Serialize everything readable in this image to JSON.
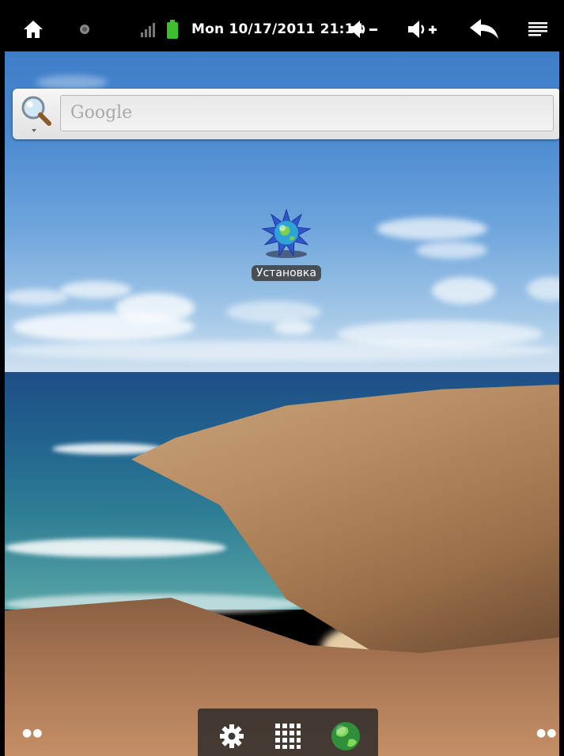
{
  "status_bar": {
    "datetime": "Mon 10/17/2011 21:14",
    "icons": [
      "home-icon",
      "circle-icon",
      "signal-icon",
      "battery-icon",
      "volume-down-icon",
      "volume-up-icon",
      "back-icon",
      "menu-icon"
    ]
  },
  "search": {
    "placeholder": "Google",
    "icon": "magnifier-icon"
  },
  "desktop": {
    "apps": [
      {
        "label": "Установка",
        "icon": "globe-sun-icon"
      }
    ]
  },
  "dock": {
    "items": [
      "settings-icon",
      "all-apps-grid-icon",
      "browser-globe-icon"
    ]
  },
  "colors": {
    "status_bar_bg": "#000000",
    "label_bg": "#3c3c3c"
  }
}
